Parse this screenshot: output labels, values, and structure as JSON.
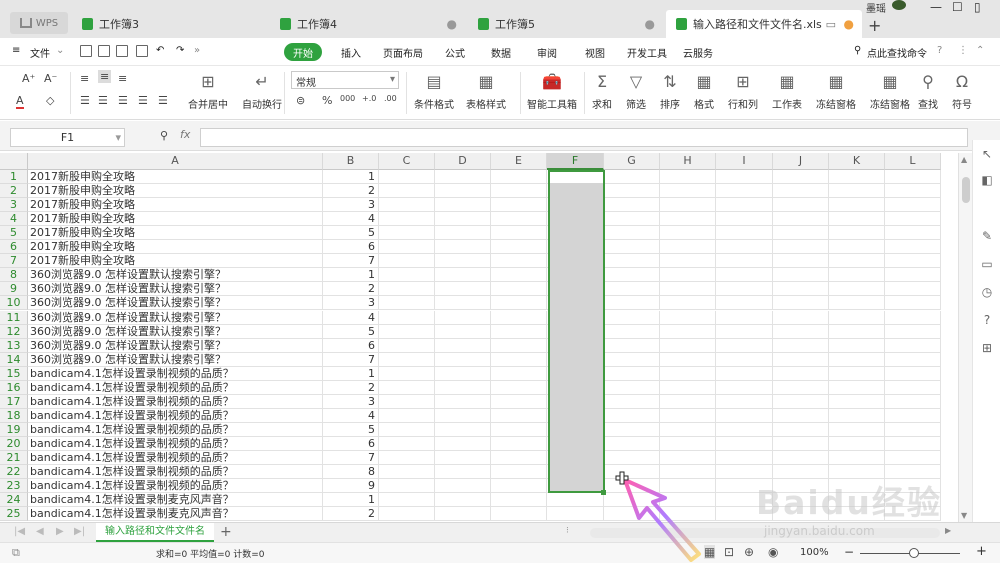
{
  "titlebar": {
    "wps_label": "WPS",
    "tabs": [
      {
        "label": "工作簿3",
        "icon_color": "#2fa23f"
      },
      {
        "label": "工作簿4",
        "icon_color": "#2fa23f"
      },
      {
        "label": "工作簿5",
        "icon_color": "#2fa23f"
      },
      {
        "label": "输入路径和文件文件名.xls",
        "icon_color": "#2fa23f"
      }
    ],
    "user": "墨瑶",
    "new_tab": "+"
  },
  "menubar": {
    "file": "文件",
    "items": [
      "开始",
      "插入",
      "页面布局",
      "公式",
      "数据",
      "审阅",
      "视图",
      "开发工具",
      "云服务"
    ],
    "search": "点此查找命令",
    "help": "?"
  },
  "ribbon": {
    "merge": "合并居中",
    "wrap": "自动换行",
    "number_format": "常规",
    "cond_format": "条件格式",
    "table_style": "表格样式",
    "smart_tools": "智能工具箱",
    "sum": "求和",
    "filter": "筛选",
    "sort": "排序",
    "format": "格式",
    "row_col": "行和列",
    "worksheet": "工作表",
    "freeze": "冻结窗格",
    "freeze2": "冻结窗格",
    "find": "查找",
    "symbol": "符号"
  },
  "formulabar": {
    "name_box": "F1",
    "fx": "fx",
    "value": ""
  },
  "grid": {
    "columns": [
      "A",
      "B",
      "C",
      "D",
      "E",
      "F",
      "G",
      "H",
      "I",
      "J",
      "K",
      "L"
    ],
    "selected_column": "F",
    "rows": [
      {
        "n": "1",
        "a": "2017新股申购全攻略",
        "b": "1"
      },
      {
        "n": "2",
        "a": "2017新股申购全攻略",
        "b": "2"
      },
      {
        "n": "3",
        "a": "2017新股申购全攻略",
        "b": "3"
      },
      {
        "n": "4",
        "a": "2017新股申购全攻略",
        "b": "4"
      },
      {
        "n": "5",
        "a": "2017新股申购全攻略",
        "b": "5"
      },
      {
        "n": "6",
        "a": "2017新股申购全攻略",
        "b": "6"
      },
      {
        "n": "7",
        "a": "2017新股申购全攻略",
        "b": "7"
      },
      {
        "n": "8",
        "a": "360浏览器9.0 怎样设置默认搜索引擎？",
        "b": "1"
      },
      {
        "n": "9",
        "a": "360浏览器9.0 怎样设置默认搜索引擎？",
        "b": "2"
      },
      {
        "n": "10",
        "a": "360浏览器9.0 怎样设置默认搜索引擎？",
        "b": "3"
      },
      {
        "n": "11",
        "a": "360浏览器9.0 怎样设置默认搜索引擎？",
        "b": "4"
      },
      {
        "n": "12",
        "a": "360浏览器9.0 怎样设置默认搜索引擎？",
        "b": "5"
      },
      {
        "n": "13",
        "a": "360浏览器9.0 怎样设置默认搜索引擎？",
        "b": "6"
      },
      {
        "n": "14",
        "a": "360浏览器9.0 怎样设置默认搜索引擎？",
        "b": "7"
      },
      {
        "n": "15",
        "a": "bandicam4.1怎样设置录制视频的品质？",
        "b": "1"
      },
      {
        "n": "16",
        "a": "bandicam4.1怎样设置录制视频的品质？",
        "b": "2"
      },
      {
        "n": "17",
        "a": "bandicam4.1怎样设置录制视频的品质？",
        "b": "3"
      },
      {
        "n": "18",
        "a": "bandicam4.1怎样设置录制视频的品质？",
        "b": "4"
      },
      {
        "n": "19",
        "a": "bandicam4.1怎样设置录制视频的品质？",
        "b": "5"
      },
      {
        "n": "20",
        "a": "bandicam4.1怎样设置录制视频的品质？",
        "b": "6"
      },
      {
        "n": "21",
        "a": "bandicam4.1怎样设置录制视频的品质？",
        "b": "7"
      },
      {
        "n": "22",
        "a": "bandicam4.1怎样设置录制视频的品质？",
        "b": "8"
      },
      {
        "n": "23",
        "a": "bandicam4.1怎样设置录制视频的品质？",
        "b": "9"
      },
      {
        "n": "24",
        "a": "bandicam4.1怎样设置录制麦克风声音？",
        "b": "1"
      },
      {
        "n": "25",
        "a": "bandicam4.1怎样设置录制麦克风声音？",
        "b": "2"
      }
    ]
  },
  "sheetbar": {
    "active_sheet": "输入路径和文件文件名",
    "add": "+"
  },
  "statusbar": {
    "summary": "求和=0  平均值=0  计数=0",
    "zoom": "100%"
  },
  "watermark": {
    "text": "Baidu经验",
    "url": "jingyan.baidu.com"
  },
  "colors": {
    "accent": "#2fa23f",
    "selection_border": "#3f9a3f",
    "selection_fill": "#d4d4d4"
  }
}
